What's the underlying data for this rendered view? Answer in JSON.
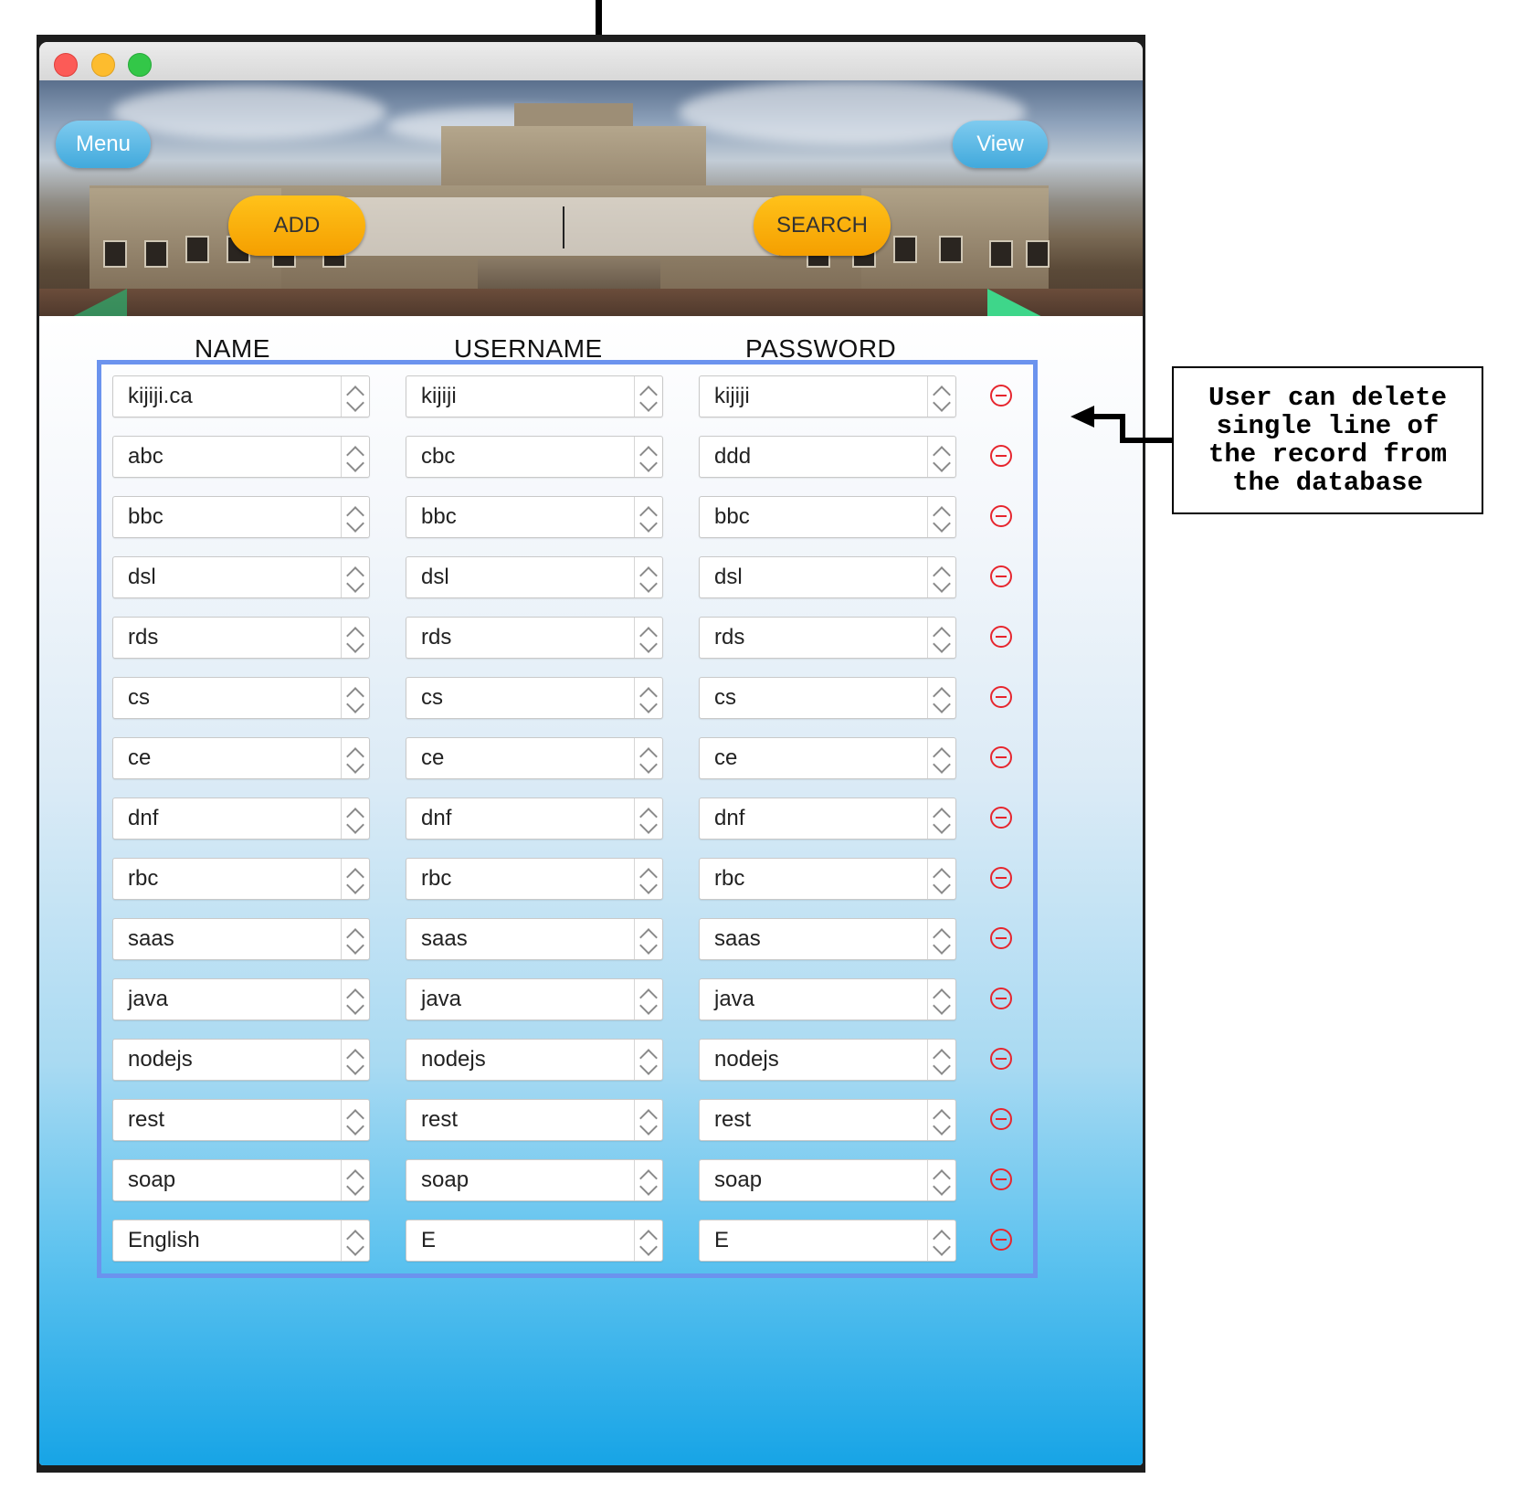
{
  "window": {
    "traffic_lights": {
      "close_color": "#fc5b57",
      "minimize_color": "#fdbc2e",
      "zoom_color": "#33c748"
    }
  },
  "toolbar": {
    "menu_label": "Menu",
    "view_label": "View",
    "add_label": "ADD",
    "search_label": "SEARCH",
    "search_value": ""
  },
  "columns": {
    "name": "NAME",
    "username": "USERNAME",
    "password": "PASSWORD"
  },
  "records": [
    {
      "name": "kijiji.ca",
      "username": "kijiji",
      "password": "kijiji"
    },
    {
      "name": "abc",
      "username": "cbc",
      "password": "ddd"
    },
    {
      "name": "bbc",
      "username": "bbc",
      "password": "bbc"
    },
    {
      "name": "dsl",
      "username": "dsl",
      "password": "dsl"
    },
    {
      "name": "rds",
      "username": "rds",
      "password": "rds"
    },
    {
      "name": "cs",
      "username": "cs",
      "password": "cs"
    },
    {
      "name": "ce",
      "username": "ce",
      "password": "ce"
    },
    {
      "name": "dnf",
      "username": "dnf",
      "password": "dnf"
    },
    {
      "name": "rbc",
      "username": "rbc",
      "password": "rbc"
    },
    {
      "name": "saas",
      "username": "saas",
      "password": "saas"
    },
    {
      "name": "java",
      "username": "java",
      "password": "java"
    },
    {
      "name": "nodejs",
      "username": "nodejs",
      "password": "nodejs"
    },
    {
      "name": "rest",
      "username": "rest",
      "password": "rest"
    },
    {
      "name": "soap",
      "username": "soap",
      "password": "soap"
    },
    {
      "name": "English",
      "username": "E",
      "password": "E"
    }
  ],
  "annotation": {
    "text": "User can delete single line of the record from the database"
  },
  "colors": {
    "accent_button": "#f59f00",
    "nav_button": "#41a9dc",
    "delete_icon": "#e6262e",
    "table_border": "#6b93ee"
  },
  "icons": [
    "delete-icon",
    "stepper-icon",
    "prev-arrow-icon",
    "next-arrow-icon"
  ]
}
